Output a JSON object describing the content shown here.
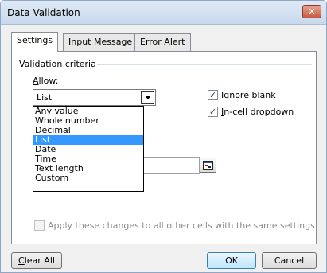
{
  "window": {
    "title": "Data Validation",
    "close_glyph": "✕"
  },
  "tabs": [
    {
      "label": "Settings",
      "active": true
    },
    {
      "label": "Input Message",
      "active": false
    },
    {
      "label": "Error Alert",
      "active": false
    }
  ],
  "criteria": {
    "group_label": "Validation criteria",
    "allow_label": "Allow:",
    "allow_value": "List",
    "options": [
      "Any value",
      "Whole number",
      "Decimal",
      "List",
      "Date",
      "Time",
      "Text length",
      "Custom"
    ],
    "selected_option": "List"
  },
  "checkboxes": {
    "ignore_blank": {
      "label": "Ignore blank",
      "checked": true
    },
    "in_cell_dropdown": {
      "label": "In-cell dropdown",
      "checked": true
    }
  },
  "apply_all": {
    "label": "Apply these changes to all other cells with the same settings",
    "checked": false,
    "disabled": true
  },
  "buttons": {
    "clear_all": "Clear All",
    "ok": "OK",
    "cancel": "Cancel"
  },
  "icons": {
    "collapse_dialog": "collapse-dialog-icon",
    "dropdown_arrow": "chevron-down-icon",
    "close": "close-icon"
  },
  "colors": {
    "selection": "#3399ff",
    "titlebar": "#c9d9ec"
  }
}
